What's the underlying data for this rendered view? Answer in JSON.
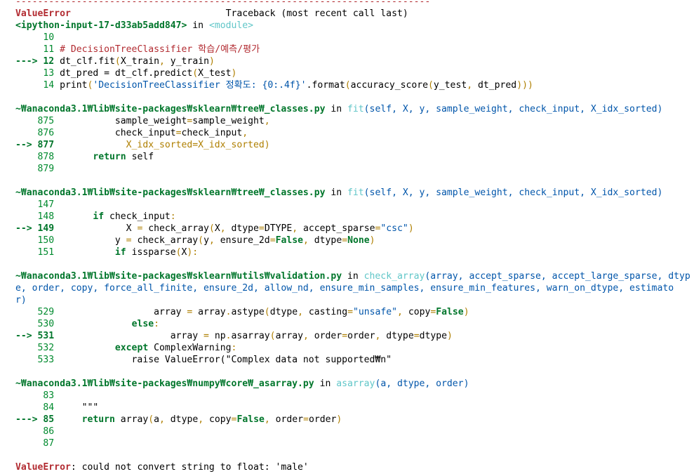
{
  "colors": {
    "error": "#b22b31",
    "frame": "#00762b",
    "lineno": "#008a2e",
    "func": "#60c6c8",
    "args": "#0055aa",
    "punct": "#af7f00"
  },
  "lines": [
    [
      [
        "---------------------------------------------------------------------------",
        "r"
      ]
    ],
    [
      [
        "ValueError",
        "rb"
      ],
      [
        "                            Traceback (most recent call last)",
        "k"
      ]
    ],
    [
      [
        "<ipython-input-17-d33ab5add847>",
        "g"
      ],
      [
        " in ",
        "k"
      ],
      [
        "<module>",
        "c"
      ]
    ],
    [
      [
        "     10",
        "n"
      ]
    ],
    [
      [
        "     11 ",
        "n"
      ],
      [
        "# DecisionTreeClassifier 학습/예측/평가",
        "cm"
      ]
    ],
    [
      [
        "---> 12 ",
        "g"
      ],
      [
        "dt_clf.fit",
        "k"
      ],
      [
        "(",
        "y"
      ],
      [
        "X_train",
        "k"
      ],
      [
        ", ",
        "y"
      ],
      [
        "y_train",
        "k"
      ],
      [
        ")",
        "y"
      ]
    ],
    [
      [
        "     13 ",
        "n"
      ],
      [
        "dt_pred = dt_clf.predict",
        "k"
      ],
      [
        "(",
        "y"
      ],
      [
        "X_test",
        "k"
      ],
      [
        ")",
        "y"
      ]
    ],
    [
      [
        "     14 ",
        "n"
      ],
      [
        "print",
        "k"
      ],
      [
        "(",
        "y"
      ],
      [
        "'DecisionTreeClassifier 정확도: {0:.4f}'",
        "b"
      ],
      [
        ".format",
        "k"
      ],
      [
        "(",
        "y"
      ],
      [
        "accuracy_score",
        "k"
      ],
      [
        "(",
        "y"
      ],
      [
        "y_test",
        "k"
      ],
      [
        ", ",
        "y"
      ],
      [
        "dt_pred",
        "k"
      ],
      [
        ")))",
        "y"
      ]
    ],
    [],
    [
      [
        "~₩anaconda3.1₩lib₩site-packages₩sklearn₩tree₩_classes.py",
        "g"
      ],
      [
        " in ",
        "k"
      ],
      [
        "fit",
        "c"
      ],
      [
        "(self, X, y, sample_weight, check_input, X_idx_sorted)",
        "b"
      ]
    ],
    [
      [
        "    875",
        "n"
      ],
      [
        "           sample_weight",
        "k"
      ],
      [
        "=",
        "y"
      ],
      [
        "sample_weight",
        "k"
      ],
      [
        ",",
        "y"
      ]
    ],
    [
      [
        "    876",
        "n"
      ],
      [
        "           check_input",
        "k"
      ],
      [
        "=",
        "y"
      ],
      [
        "check_input",
        "k"
      ],
      [
        ",",
        "y"
      ]
    ],
    [
      [
        "--> 877",
        "g"
      ],
      [
        "             X_idx_sorted=X_idx_sorted)",
        "y"
      ]
    ],
    [
      [
        "    878",
        "n"
      ],
      [
        "       ",
        "k"
      ],
      [
        "return",
        "g"
      ],
      [
        " self",
        "k"
      ]
    ],
    [
      [
        "    879",
        "n"
      ]
    ],
    [],
    [
      [
        "~₩anaconda3.1₩lib₩site-packages₩sklearn₩tree₩_classes.py",
        "g"
      ],
      [
        " in ",
        "k"
      ],
      [
        "fit",
        "c"
      ],
      [
        "(self, X, y, sample_weight, check_input, X_idx_sorted)",
        "b"
      ]
    ],
    [
      [
        "    147",
        "n"
      ]
    ],
    [
      [
        "    148",
        "n"
      ],
      [
        "       ",
        "k"
      ],
      [
        "if",
        "g"
      ],
      [
        " check_input",
        "k"
      ],
      [
        ":",
        "y"
      ]
    ],
    [
      [
        "--> 149",
        "g"
      ],
      [
        "             X ",
        "k"
      ],
      [
        "=",
        "y"
      ],
      [
        " check_array",
        "k"
      ],
      [
        "(",
        "y"
      ],
      [
        "X",
        "k"
      ],
      [
        ", ",
        "y"
      ],
      [
        "dtype",
        "k"
      ],
      [
        "=",
        "y"
      ],
      [
        "DTYPE",
        "k"
      ],
      [
        ", ",
        "y"
      ],
      [
        "accept_sparse",
        "k"
      ],
      [
        "=",
        "y"
      ],
      [
        "\"csc\"",
        "b"
      ],
      [
        ")",
        "y"
      ]
    ],
    [
      [
        "    150",
        "n"
      ],
      [
        "           y ",
        "k"
      ],
      [
        "=",
        "y"
      ],
      [
        " check_array",
        "k"
      ],
      [
        "(",
        "y"
      ],
      [
        "y",
        "k"
      ],
      [
        ", ",
        "y"
      ],
      [
        "ensure_2d",
        "k"
      ],
      [
        "=",
        "y"
      ],
      [
        "False",
        "g"
      ],
      [
        ", ",
        "y"
      ],
      [
        "dtype",
        "k"
      ],
      [
        "=",
        "y"
      ],
      [
        "None",
        "g"
      ],
      [
        ")",
        "y"
      ]
    ],
    [
      [
        "    151",
        "n"
      ],
      [
        "           ",
        "k"
      ],
      [
        "if",
        "g"
      ],
      [
        " issparse",
        "k"
      ],
      [
        "(",
        "y"
      ],
      [
        "X",
        "k"
      ],
      [
        "):",
        "y"
      ]
    ],
    [],
    [
      [
        "~₩anaconda3.1₩lib₩site-packages₩sklearn₩utils₩validation.py",
        "g"
      ],
      [
        " in ",
        "k"
      ],
      [
        "check_array",
        "c"
      ],
      [
        "(array, accept_sparse, accept_large_sparse, dtyp",
        "b"
      ]
    ],
    [
      [
        "e, order, copy, force_all_finite, ensure_2d, allow_nd, ensure_min_samples, ensure_min_features, warn_on_dtype, estimato",
        "b"
      ]
    ],
    [
      [
        "r)",
        "b"
      ]
    ],
    [
      [
        "    529",
        "n"
      ],
      [
        "                  array ",
        "k"
      ],
      [
        "=",
        "y"
      ],
      [
        " array",
        "k"
      ],
      [
        ".",
        "y"
      ],
      [
        "astype",
        "k"
      ],
      [
        "(",
        "y"
      ],
      [
        "dtype",
        "k"
      ],
      [
        ", ",
        "y"
      ],
      [
        "casting",
        "k"
      ],
      [
        "=",
        "y"
      ],
      [
        "\"unsafe\"",
        "b"
      ],
      [
        ", ",
        "y"
      ],
      [
        "copy",
        "k"
      ],
      [
        "=",
        "y"
      ],
      [
        "False",
        "g"
      ],
      [
        ")",
        "y"
      ]
    ],
    [
      [
        "    530",
        "n"
      ],
      [
        "              ",
        "k"
      ],
      [
        "else",
        "g"
      ],
      [
        ":",
        "y"
      ]
    ],
    [
      [
        "--> 531",
        "g"
      ],
      [
        "                     array ",
        "k"
      ],
      [
        "=",
        "y"
      ],
      [
        " np",
        "k"
      ],
      [
        ".",
        "y"
      ],
      [
        "asarray",
        "k"
      ],
      [
        "(",
        "y"
      ],
      [
        "array",
        "k"
      ],
      [
        ", ",
        "y"
      ],
      [
        "order",
        "k"
      ],
      [
        "=",
        "y"
      ],
      [
        "order",
        "k"
      ],
      [
        ", ",
        "y"
      ],
      [
        "dtype",
        "k"
      ],
      [
        "=",
        "y"
      ],
      [
        "dtype",
        "k"
      ],
      [
        ")",
        "y"
      ]
    ],
    [
      [
        "    532",
        "n"
      ],
      [
        "           ",
        "k"
      ],
      [
        "except",
        "g"
      ],
      [
        " ComplexWarning",
        "k"
      ],
      [
        ":",
        "y"
      ]
    ],
    [
      [
        "    533",
        "n"
      ],
      [
        "              raise ValueError(\"Complex data not supported₩n\"",
        "k"
      ]
    ],
    [],
    [
      [
        "~₩anaconda3.1₩lib₩site-packages₩numpy₩core₩_asarray.py",
        "g"
      ],
      [
        " in ",
        "k"
      ],
      [
        "asarray",
        "c"
      ],
      [
        "(a, dtype, order)",
        "b"
      ]
    ],
    [
      [
        "     83",
        "n"
      ]
    ],
    [
      [
        "     84",
        "n"
      ],
      [
        "     \"\"\"",
        "k"
      ]
    ],
    [
      [
        "---> 85",
        "g"
      ],
      [
        "     ",
        "k"
      ],
      [
        "return",
        "g"
      ],
      [
        " array",
        "k"
      ],
      [
        "(",
        "y"
      ],
      [
        "a",
        "k"
      ],
      [
        ", ",
        "y"
      ],
      [
        "dtype",
        "k"
      ],
      [
        ", ",
        "y"
      ],
      [
        "copy",
        "k"
      ],
      [
        "=",
        "y"
      ],
      [
        "False",
        "g"
      ],
      [
        ", ",
        "y"
      ],
      [
        "order",
        "k"
      ],
      [
        "=",
        "y"
      ],
      [
        "order",
        "k"
      ],
      [
        ")",
        "y"
      ]
    ],
    [
      [
        "     86",
        "n"
      ]
    ],
    [
      [
        "     87",
        "n"
      ]
    ],
    [],
    [
      [
        "ValueError",
        "rb"
      ],
      [
        ": could not convert string to float: 'male'",
        "k"
      ]
    ]
  ]
}
